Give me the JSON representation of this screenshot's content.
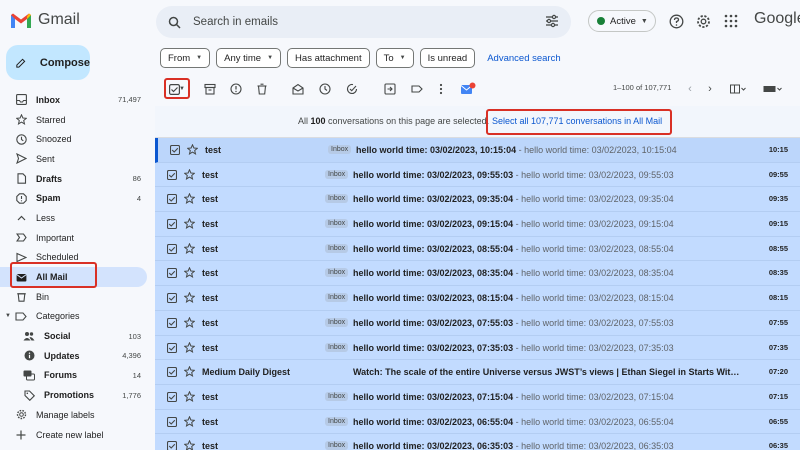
{
  "app": {
    "name": "Gmail",
    "google": "Google"
  },
  "compose_label": "Compose",
  "search": {
    "placeholder": "Search in emails"
  },
  "status": {
    "label": "Active"
  },
  "nav": [
    {
      "label": "Inbox",
      "count": "71,497",
      "bold": true,
      "icon": "inbox-icon"
    },
    {
      "label": "Starred",
      "count": "",
      "bold": false,
      "icon": "star-icon"
    },
    {
      "label": "Snoozed",
      "count": "",
      "bold": false,
      "icon": "clock-icon"
    },
    {
      "label": "Sent",
      "count": "",
      "bold": false,
      "icon": "send-icon"
    },
    {
      "label": "Drafts",
      "count": "86",
      "bold": true,
      "icon": "draft-icon"
    },
    {
      "label": "Spam",
      "count": "4",
      "bold": true,
      "icon": "spam-icon"
    },
    {
      "label": "Less",
      "count": "",
      "bold": false,
      "icon": "chevron-up-icon"
    },
    {
      "label": "Important",
      "count": "",
      "bold": false,
      "icon": "important-icon"
    },
    {
      "label": "Scheduled",
      "count": "",
      "bold": false,
      "icon": "scheduled-icon"
    },
    {
      "label": "All Mail",
      "count": "",
      "bold": true,
      "icon": "all-mail-icon",
      "active": true
    },
    {
      "label": "Bin",
      "count": "",
      "bold": false,
      "icon": "trash-icon"
    },
    {
      "label": "Categories",
      "count": "",
      "bold": false,
      "icon": "label-icon"
    },
    {
      "label": "Social",
      "count": "103",
      "bold": true,
      "icon": "people-icon",
      "sub": true
    },
    {
      "label": "Updates",
      "count": "4,396",
      "bold": true,
      "icon": "info-icon",
      "sub": true
    },
    {
      "label": "Forums",
      "count": "14",
      "bold": true,
      "icon": "forum-icon",
      "sub": true
    },
    {
      "label": "Promotions",
      "count": "1,776",
      "bold": true,
      "icon": "tag-icon",
      "sub": true
    },
    {
      "label": "Manage labels",
      "count": "",
      "bold": false,
      "icon": "gear-icon"
    },
    {
      "label": "Create new label",
      "count": "",
      "bold": false,
      "icon": "plus-icon"
    }
  ],
  "chips": [
    {
      "label": "From",
      "dropdown": true
    },
    {
      "label": "Any time",
      "dropdown": true
    },
    {
      "label": "Has attachment",
      "dropdown": false
    },
    {
      "label": "To",
      "dropdown": true
    },
    {
      "label": "Is unread",
      "dropdown": false
    }
  ],
  "advanced_search": "Advanced search",
  "pager": "1–100 of 107,771",
  "banner": {
    "prefix": "All ",
    "count": "100",
    "suffix": " conversations on this page are selected.",
    "link": "Select all 107,771 conversations in All Mail"
  },
  "emails": [
    {
      "sender": "test",
      "tag": "Inbox",
      "subject": "hello world time: 03/02/2023, 10:15:04",
      "snippet": " - hello world time: 03/02/2023, 10:15:04",
      "time": "10:15"
    },
    {
      "sender": "test",
      "tag": "Inbox",
      "subject": "hello world time: 03/02/2023, 09:55:03",
      "snippet": " - hello world time: 03/02/2023, 09:55:03",
      "time": "09:55"
    },
    {
      "sender": "test",
      "tag": "Inbox",
      "subject": "hello world time: 03/02/2023, 09:35:04",
      "snippet": " - hello world time: 03/02/2023, 09:35:04",
      "time": "09:35"
    },
    {
      "sender": "test",
      "tag": "Inbox",
      "subject": "hello world time: 03/02/2023, 09:15:04",
      "snippet": " - hello world time: 03/02/2023, 09:15:04",
      "time": "09:15"
    },
    {
      "sender": "test",
      "tag": "Inbox",
      "subject": "hello world time: 03/02/2023, 08:55:04",
      "snippet": " - hello world time: 03/02/2023, 08:55:04",
      "time": "08:55"
    },
    {
      "sender": "test",
      "tag": "Inbox",
      "subject": "hello world time: 03/02/2023, 08:35:04",
      "snippet": " - hello world time: 03/02/2023, 08:35:04",
      "time": "08:35"
    },
    {
      "sender": "test",
      "tag": "Inbox",
      "subject": "hello world time: 03/02/2023, 08:15:04",
      "snippet": " - hello world time: 03/02/2023, 08:15:04",
      "time": "08:15"
    },
    {
      "sender": "test",
      "tag": "Inbox",
      "subject": "hello world time: 03/02/2023, 07:55:03",
      "snippet": " - hello world time: 03/02/2023, 07:55:03",
      "time": "07:55"
    },
    {
      "sender": "test",
      "tag": "Inbox",
      "subject": "hello world time: 03/02/2023, 07:35:03",
      "snippet": " - hello world time: 03/02/2023, 07:35:03",
      "time": "07:35"
    },
    {
      "sender": "Medium Daily Digest",
      "tag": "",
      "subject": "Watch: The scale of the entire Universe versus JWST’s views | Ethan Siegel in Starts Wit…",
      "snippet": "",
      "time": "07:20"
    },
    {
      "sender": "test",
      "tag": "Inbox",
      "subject": "hello world time: 03/02/2023, 07:15:04",
      "snippet": " - hello world time: 03/02/2023, 07:15:04",
      "time": "07:15"
    },
    {
      "sender": "test",
      "tag": "Inbox",
      "subject": "hello world time: 03/02/2023, 06:55:04",
      "snippet": " - hello world time: 03/02/2023, 06:55:04",
      "time": "06:55"
    },
    {
      "sender": "test",
      "tag": "Inbox",
      "subject": "hello world time: 03/02/2023, 06:35:03",
      "snippet": " - hello world time: 03/02/2023, 06:35:03",
      "time": "06:35"
    }
  ],
  "colors": {
    "accent": "#0b57d0",
    "selected_row": "#c2dbff",
    "compose": "#c2e7ff",
    "highlight": "#d93025"
  }
}
